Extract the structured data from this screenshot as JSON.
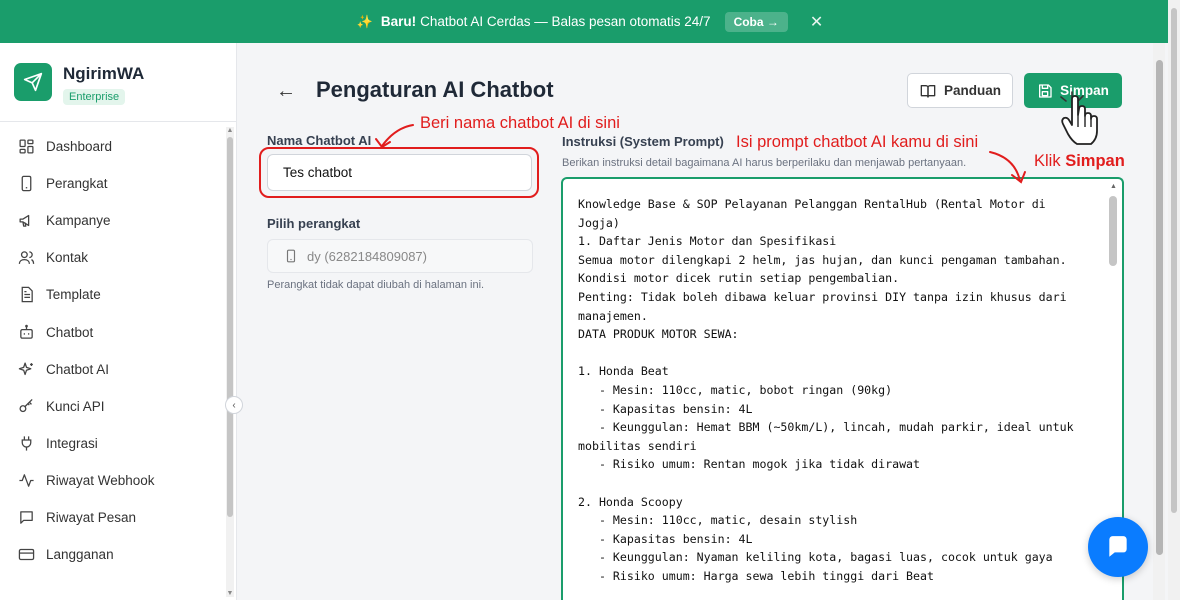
{
  "banner": {
    "bold": "Baru!",
    "text": "Chatbot AI Cerdas — Balas pesan otomatis 24/7",
    "cta": "Coba →",
    "close": "✕"
  },
  "brand": {
    "name": "NgirimWA",
    "plan": "Enterprise"
  },
  "sidebar": {
    "items": [
      {
        "label": "Dashboard",
        "icon": "dashboard-icon"
      },
      {
        "label": "Perangkat",
        "icon": "phone-icon"
      },
      {
        "label": "Kampanye",
        "icon": "megaphone-icon"
      },
      {
        "label": "Kontak",
        "icon": "users-icon"
      },
      {
        "label": "Template",
        "icon": "document-icon"
      },
      {
        "label": "Chatbot",
        "icon": "bot-icon"
      },
      {
        "label": "Chatbot AI",
        "icon": "sparkles-icon"
      },
      {
        "label": "Kunci API",
        "icon": "key-icon"
      },
      {
        "label": "Integrasi",
        "icon": "plug-icon"
      },
      {
        "label": "Riwayat Webhook",
        "icon": "activity-icon"
      },
      {
        "label": "Riwayat Pesan",
        "icon": "message-icon"
      },
      {
        "label": "Langganan",
        "icon": "card-icon"
      }
    ]
  },
  "page": {
    "back": "←",
    "title": "Pengaturan AI Chatbot"
  },
  "toolbar": {
    "guide_label": "Panduan",
    "save_label": "Simpan"
  },
  "form": {
    "name_label": "Nama Chatbot AI",
    "name_value": "Tes chatbot",
    "device_label": "Pilih perangkat",
    "device_value": "dy (6282184809087)",
    "device_hint": "Perangkat tidak dapat diubah di halaman ini.",
    "prompt_label": "Instruksi (System Prompt)",
    "prompt_hint": "Berikan instruksi detail bagaimana AI harus berperilaku dan menjawab pertanyaan.",
    "prompt_value": "Knowledge Base & SOP Pelayanan Pelanggan RentalHub (Rental Motor di\nJogja)\n1. Daftar Jenis Motor dan Spesifikasi\nSemua motor dilengkapi 2 helm, jas hujan, dan kunci pengaman tambahan.\nKondisi motor dicek rutin setiap pengembalian.\nPenting: Tidak boleh dibawa keluar provinsi DIY tanpa izin khusus dari\nmanajemen.\nDATA PRODUK MOTOR SEWA:\n\n1. Honda Beat\n   - Mesin: 110cc, matic, bobot ringan (90kg)\n   - Kapasitas bensin: 4L\n   - Keunggulan: Hemat BBM (~50km/L), lincah, mudah parkir, ideal untuk\nmobilitas sendiri\n   - Risiko umum: Rentan mogok jika tidak dirawat\n\n2. Honda Scoopy\n   - Mesin: 110cc, matic, desain stylish\n   - Kapasitas bensin: 4L\n   - Keunggulan: Nyaman keliling kota, bagasi luas, cocok untuk gaya\n   - Risiko umum: Harga sewa lebih tinggi dari Beat"
  },
  "annotations": {
    "name": "Beri nama chatbot AI di sini",
    "prompt": "Isi prompt chatbot AI kamu di sini",
    "save_prefix": "Klik",
    "save_bold": "Simpan"
  },
  "colors": {
    "accent": "#1a9d6b",
    "annotation": "#e11d1d",
    "chat_button": "#0a7cff"
  }
}
